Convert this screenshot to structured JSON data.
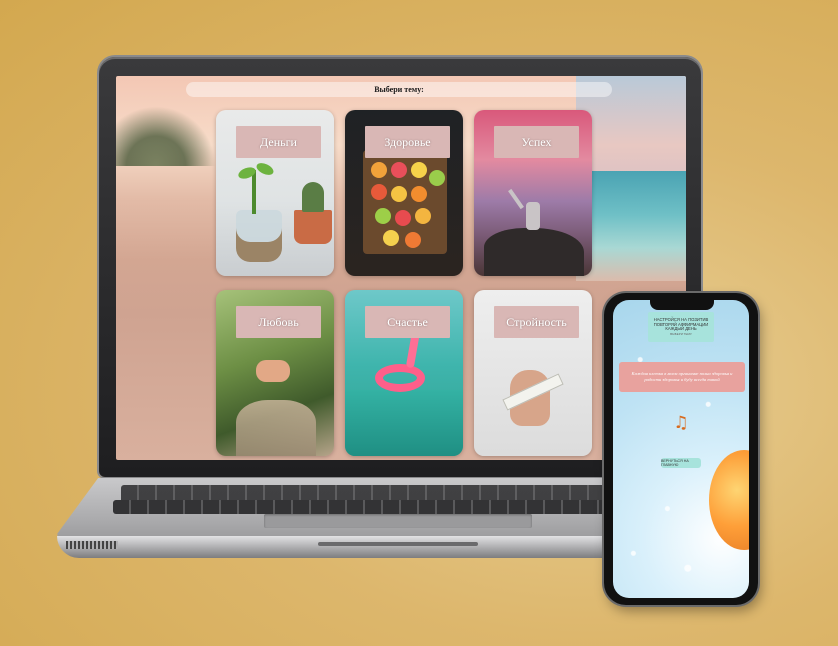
{
  "desktop": {
    "prompt": "Выбери тему:",
    "topics": [
      {
        "label": "Деньги"
      },
      {
        "label": "Здоровье"
      },
      {
        "label": "Успех"
      },
      {
        "label": "Любовь"
      },
      {
        "label": "Счастье"
      },
      {
        "label": "Стройность"
      }
    ]
  },
  "phone": {
    "header": {
      "line1": "НАСТРОЙСЯ НА ПОЗИТИВ",
      "line2": "ПОВТОРЯЙ АФФИРМАЦИИ КАЖДЫЙ ДЕНЬ",
      "line3": "ВЫБЕРИ ТЕМУ"
    },
    "quote": "Каждая клетка в моем организме полна здоровья и радости здоровья и буду всегда такой",
    "music_icon": "music-note-icon",
    "music_glyph": "♫",
    "back_label": "ВЕРНУТЬСЯ НА ГЛАВНУЮ"
  },
  "colors": {
    "background": "#ddb76d",
    "card_label": "#d9b7b5",
    "phone_header": "#a7e3dc",
    "phone_quote": "#e8a29e"
  }
}
